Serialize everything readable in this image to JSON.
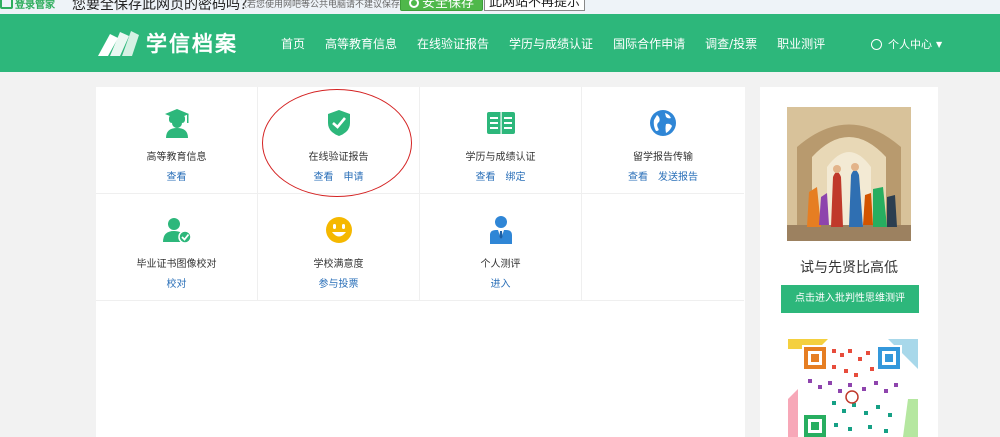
{
  "password_bar": {
    "login_tag": "登录管家",
    "question": "您要全保存此网页的密码吗？",
    "hint": "（若您使用网吧等公共电脑请不建议保存）",
    "save_button": "安全保存",
    "never_button": "此网站不再提示"
  },
  "header": {
    "logo_text": "学信档案",
    "nav": [
      "首页",
      "高等教育信息",
      "在线验证报告",
      "学历与成绩认证",
      "国际合作申请",
      "调查/投票",
      "职业测评"
    ],
    "user_menu": "个人中心"
  },
  "services": [
    {
      "title": "高等教育信息",
      "links": [
        "查看"
      ],
      "icon": "graduate-icon",
      "color": "#2db77b"
    },
    {
      "title": "在线验证报告",
      "links": [
        "查看",
        "申请"
      ],
      "icon": "shield-check-icon",
      "color": "#2db77b"
    },
    {
      "title": "学历与成绩认证",
      "links": [
        "查看",
        "绑定"
      ],
      "icon": "book-icon",
      "color": "#2db77b"
    },
    {
      "title": "留学报告传输",
      "links": [
        "查看",
        "发送报告"
      ],
      "icon": "globe-icon",
      "color": "#2f86d6"
    },
    {
      "title": "毕业证书图像校对",
      "links": [
        "校对"
      ],
      "icon": "user-check-icon",
      "color": "#2db77b"
    },
    {
      "title": "学校满意度",
      "links": [
        "参与投票"
      ],
      "icon": "smiley-icon",
      "color": "#f5b800"
    },
    {
      "title": "个人测评",
      "links": [
        "进入"
      ],
      "icon": "person-tie-icon",
      "color": "#2f86d6"
    }
  ],
  "sidebar": {
    "title": "试与先贤比高低",
    "button": "点击进入批判性思维测评"
  }
}
